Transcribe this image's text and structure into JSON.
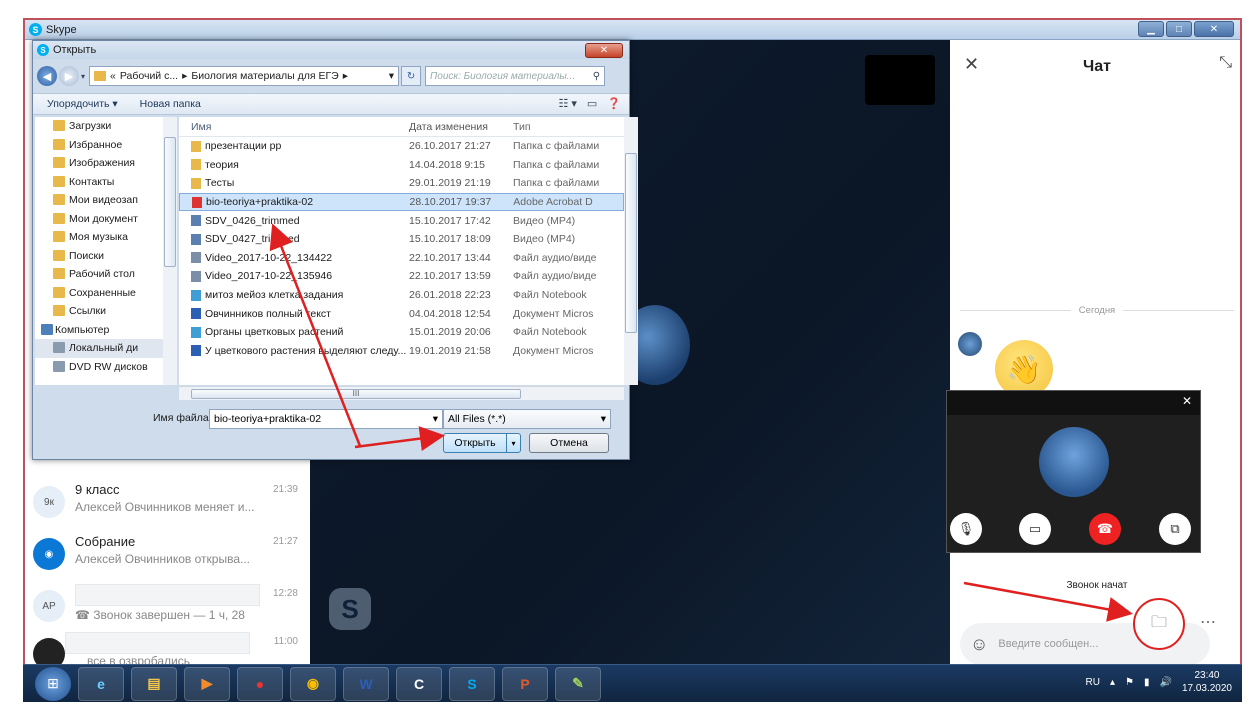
{
  "app": {
    "title": "Skype"
  },
  "dialog": {
    "title": "Открыть",
    "breadcrumb": [
      "«",
      "Рабочий с...",
      "Биология материалы для ЕГЭ"
    ],
    "search_placeholder": "Поиск: Биология материалы...",
    "toolbar": {
      "organize": "Упорядочить ▾",
      "new_folder": "Новая папка"
    },
    "nav_items": [
      {
        "label": "Загрузки",
        "selected": false
      },
      {
        "label": "Избранное",
        "selected": false
      },
      {
        "label": "Изображения",
        "selected": false
      },
      {
        "label": "Контакты",
        "selected": false
      },
      {
        "label": "Мои видеозап",
        "selected": false
      },
      {
        "label": "Мои документ",
        "selected": false
      },
      {
        "label": "Моя музыка",
        "selected": false
      },
      {
        "label": "Поиски",
        "selected": false
      },
      {
        "label": "Рабочий стол",
        "selected": false
      },
      {
        "label": "Сохраненные",
        "selected": false
      },
      {
        "label": "Ссылки",
        "selected": false
      },
      {
        "label": "Компьютер",
        "selected": false
      },
      {
        "label": "Локальный ди",
        "selected": true
      },
      {
        "label": "DVD RW дисков",
        "selected": false
      }
    ],
    "columns": {
      "name": "Имя",
      "date": "Дата изменения",
      "type": "Тип"
    },
    "files": [
      {
        "name": "презентации рр",
        "date": "26.10.2017 21:27",
        "type": "Папка с файлами",
        "icon": "folder",
        "selected": false
      },
      {
        "name": "теория",
        "date": "14.04.2018 9:15",
        "type": "Папка с файлами",
        "icon": "folder",
        "selected": false
      },
      {
        "name": "Тесты",
        "date": "29.01.2019 21:19",
        "type": "Папка с файлами",
        "icon": "folder",
        "selected": false
      },
      {
        "name": "bio-teoriya+praktika-02",
        "date": "28.10.2017 19:37",
        "type": "Adobe Acrobat D",
        "icon": "pdf",
        "selected": true
      },
      {
        "name": "SDV_0426_trimmed",
        "date": "15.10.2017 17:42",
        "type": "Видео (MP4)",
        "icon": "video",
        "selected": false
      },
      {
        "name": "SDV_0427_trimmed",
        "date": "15.10.2017 18:09",
        "type": "Видео (MP4)",
        "icon": "video",
        "selected": false
      },
      {
        "name": "Video_2017-10-22_134422",
        "date": "22.10.2017 13:44",
        "type": "Файл аудио/виде",
        "icon": "media",
        "selected": false
      },
      {
        "name": "Video_2017-10-22_135946",
        "date": "22.10.2017 13:59",
        "type": "Файл аудио/виде",
        "icon": "media",
        "selected": false
      },
      {
        "name": "митоз мейоз клетка задания",
        "date": "26.01.2018 22:23",
        "type": "Файл Notebook",
        "icon": "notebook",
        "selected": false
      },
      {
        "name": "Овчинников полный текст",
        "date": "04.04.2018 12:54",
        "type": "Документ Micros",
        "icon": "word",
        "selected": false
      },
      {
        "name": "Органы цветковых растений",
        "date": "15.01.2019 20:06",
        "type": "Файл Notebook",
        "icon": "notebook",
        "selected": false
      },
      {
        "name": "У цветкового растения выделяют следу...",
        "date": "19.01.2019 21:58",
        "type": "Документ Micros",
        "icon": "word",
        "selected": false
      }
    ],
    "scroll_marker": "III",
    "filename_label": "Имя файла:",
    "filename_value": "bio-teoriya+praktika-02",
    "filter_value": "All Files (*.*)",
    "open_label": "Открыть",
    "cancel_label": "Отмена"
  },
  "chats": [
    {
      "initials": "9к",
      "name": "9 класс",
      "preview": "Алексей Овчинников меняет и...",
      "time": "21:39"
    },
    {
      "initials": "",
      "name": "Собрание",
      "preview": "Алексей Овчинников открыва...",
      "time": "21:27"
    },
    {
      "initials": "АР",
      "name": "",
      "preview": "Звонок завершен — 1 ч, 28",
      "time": "12:28"
    },
    {
      "initials": "",
      "name": "",
      "preview": "все в озвробались",
      "time": "11:00"
    }
  ],
  "chat_panel": {
    "title": "Чат",
    "today": "Сегодня",
    "call_started": "Звонок начат",
    "input_placeholder": "Введите сообщен..."
  },
  "skype_logo": "S",
  "taskbar": {
    "lang": "RU",
    "time": "23:40",
    "date": "17.03.2020"
  },
  "colors": {
    "accent": "#00aff0",
    "annotation": "#e02020",
    "end_call": "#e22222"
  }
}
